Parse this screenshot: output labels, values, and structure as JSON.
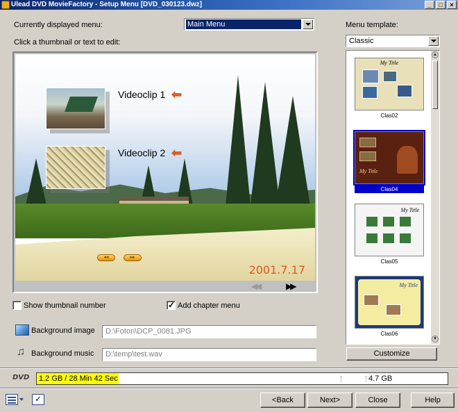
{
  "window": {
    "title": "Ulead DVD MovieFactory - Setup Menu    [DVD_030123.dwz]",
    "min_label": "_",
    "max_label": "□",
    "close_label": "×"
  },
  "menu_selector": {
    "label": "Currently displayed menu:",
    "value": "Main Menu"
  },
  "instruction": "Click a thumbnail or text to edit:",
  "preview": {
    "items": [
      {
        "caption": "Videoclip 1"
      },
      {
        "caption": "Videoclip 2"
      }
    ],
    "timestamp": "2001.7.17",
    "nav_prev_glyph": "◂◂",
    "nav_next_glyph": "▸▸",
    "page_prev_glyph": "◀◀",
    "page_next_glyph": "▶▶"
  },
  "options": {
    "show_thumbnail_number": {
      "label": "Show thumbnail number",
      "checked": false
    },
    "add_chapter_menu": {
      "label": "Add chapter menu",
      "checked": true
    }
  },
  "background_image": {
    "label": "Background image",
    "path": "D:\\Foton\\DCP_0081.JPG"
  },
  "background_music": {
    "label": "Background music",
    "path": "D:\\temp\\test.wav",
    "icon": "music-note-icon"
  },
  "template_panel": {
    "label": "Menu template:",
    "category": "Classic",
    "templates": [
      {
        "name": "Clas02",
        "thumb_title": "My Title",
        "selected": false
      },
      {
        "name": "Clas04",
        "thumb_title": "My Title",
        "selected": true
      },
      {
        "name": "Clas05",
        "thumb_title": "My Title",
        "selected": false
      },
      {
        "name": "Clas06",
        "thumb_title": "My Title",
        "selected": false
      }
    ],
    "customize_label": "Customize"
  },
  "disc_usage": {
    "disc_type": "DVD",
    "used": "1.2 GB / 28 Min 42 Sec",
    "capacity": "4.7 GB",
    "used_fraction": 0.2,
    "used_color": "#ffff00"
  },
  "footer": {
    "back_label": "<Back",
    "next_label": "Next>",
    "close_label": "Close",
    "help_label": "Help"
  }
}
